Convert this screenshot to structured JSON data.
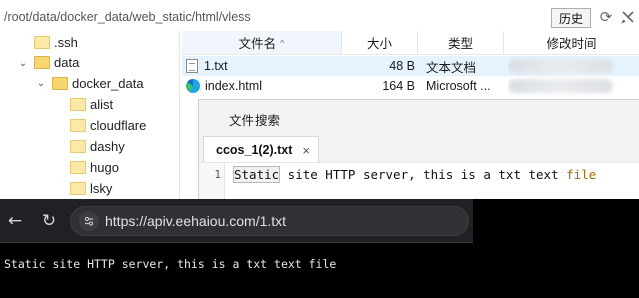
{
  "explorer": {
    "path": "/root/data/docker_data/web_static/html/vless",
    "history_button": "历史",
    "tree": [
      {
        "label": ".ssh"
      },
      {
        "label": "data"
      },
      {
        "label": "docker_data"
      },
      {
        "label": "alist"
      },
      {
        "label": "cloudflare"
      },
      {
        "label": "dashy"
      },
      {
        "label": "hugo"
      },
      {
        "label": "lsky"
      }
    ],
    "columns": {
      "name": "文件名",
      "size": "大小",
      "type": "类型",
      "mtime": "修改时间"
    },
    "files": [
      {
        "name": "1.txt",
        "size": "48 B",
        "type": "文本文档",
        "icon": "text-file-icon"
      },
      {
        "name": "index.html",
        "size": "164 B",
        "type": "Microsoft ...",
        "icon": "edge-icon"
      }
    ]
  },
  "notepad": {
    "menu": [
      "文件",
      "搜索"
    ],
    "tab_title": "ccos_1(2).txt",
    "tab_close": "×",
    "line_number": "1",
    "content": {
      "w1": "Static",
      "mid": " site HTTP server, this is a txt text ",
      "w2": "file"
    }
  },
  "browser": {
    "url": "https://apiv.eehaiou.com/1.txt",
    "page_text": "Static site HTTP server, this is a txt text file"
  }
}
